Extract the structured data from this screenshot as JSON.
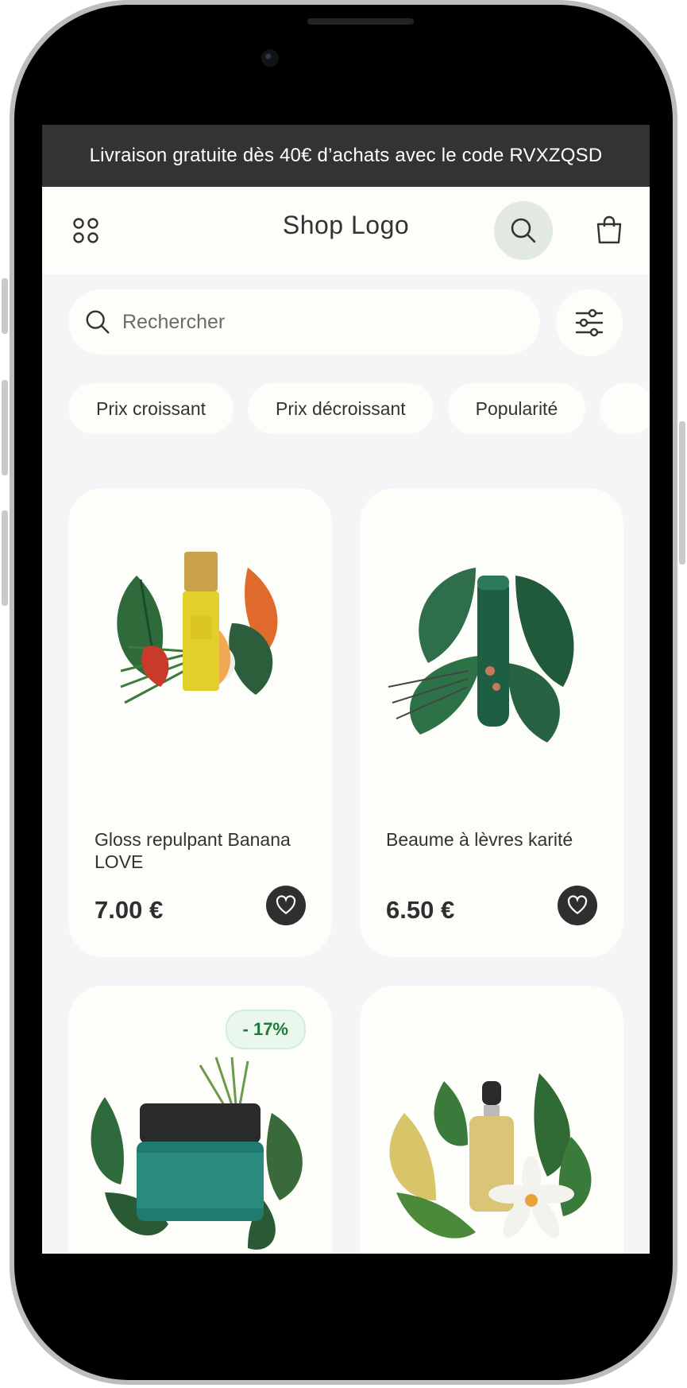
{
  "promo_banner": {
    "text": "Livraison gratuite dès 40€ d’achats avec le code RVXZQSD"
  },
  "header": {
    "logo_text": "Shop Logo"
  },
  "search": {
    "placeholder": "Rechercher"
  },
  "sort_chips": [
    "Prix croissant",
    "Prix décroissant",
    "Popularité",
    ""
  ],
  "products": [
    {
      "name": "Gloss repulpant Banana LOVE",
      "price": "7.00 €",
      "badge": ""
    },
    {
      "name": "Beaume à lèvres karité",
      "price": "6.50 €",
      "badge": ""
    },
    {
      "name": "",
      "price": "",
      "badge": "- 17%"
    },
    {
      "name": "",
      "price": "",
      "badge": ""
    }
  ],
  "colors": {
    "promo_bg": "#333333",
    "page_bg": "#f4f5f7",
    "card_bg": "#fdfdf9",
    "search_highlight": "#e2e9e3",
    "badge_green": "#1f7a3a"
  },
  "icons": [
    "grid-icon",
    "search-icon",
    "shopping-bag-icon",
    "filter-sliders-icon",
    "heart-icon"
  ]
}
